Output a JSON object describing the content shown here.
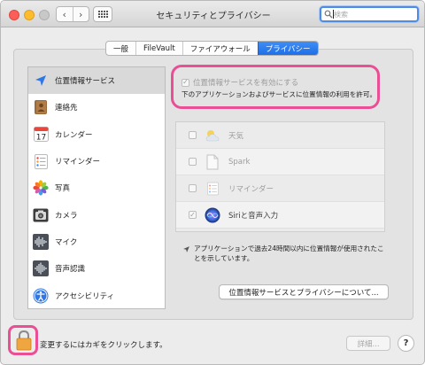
{
  "window": {
    "title": "セキュリティとプライバシー"
  },
  "toolbar": {
    "back_glyph": "‹",
    "forward_glyph": "›"
  },
  "search": {
    "placeholder": "検索"
  },
  "tabs": [
    {
      "label": "一般",
      "active": false
    },
    {
      "label": "FileVault",
      "active": false
    },
    {
      "label": "ファイアウォール",
      "active": false
    },
    {
      "label": "プライバシー",
      "active": true
    }
  ],
  "services": [
    {
      "label": "位置情報サービス",
      "icon": "location-arrow-icon",
      "selected": true
    },
    {
      "label": "連絡先",
      "icon": "contacts-book-icon",
      "selected": false
    },
    {
      "label": "カレンダー",
      "icon": "calendar-icon",
      "calendar_day": "17",
      "selected": false
    },
    {
      "label": "リマインダー",
      "icon": "reminders-list-icon",
      "selected": false
    },
    {
      "label": "写真",
      "icon": "photos-flower-icon",
      "selected": false
    },
    {
      "label": "カメラ",
      "icon": "camera-icon",
      "selected": false
    },
    {
      "label": "マイク",
      "icon": "microphone-waveform-icon",
      "selected": false
    },
    {
      "label": "音声認識",
      "icon": "speech-waveform-icon",
      "selected": false
    },
    {
      "label": "アクセシビリティ",
      "icon": "accessibility-icon",
      "selected": false
    }
  ],
  "location": {
    "enable_label": "位置情報サービスを有効にする",
    "enable_checked": true,
    "enable_disabled": true,
    "description": "下のアプリケーションおよびサービスに位置情報の利用を許可。"
  },
  "apps": [
    {
      "label": "天気",
      "icon": "weather-icon",
      "checked": false
    },
    {
      "label": "Spark",
      "icon": "document-icon",
      "checked": false
    },
    {
      "label": "リマインダー",
      "icon": "reminders-list-icon",
      "checked": false
    },
    {
      "label": "Siriと音声入力",
      "icon": "siri-icon",
      "checked": true
    }
  ],
  "note": {
    "text": "アプリケーションで過去24時間以内に位置情報が使用されたことを示しています。"
  },
  "about_button": {
    "label": "位置情報サービスとプライバシーについて..."
  },
  "bottom": {
    "lock_label": "変更するにはカギをクリックします。",
    "detail_label": "詳細...",
    "help_label": "?"
  },
  "colors": {
    "tab_active": "#2478ee",
    "highlight": "#ea4f95",
    "traffic_close": "#fc5f57",
    "traffic_minimize": "#fdbc2e",
    "lock": "#f0a640"
  }
}
